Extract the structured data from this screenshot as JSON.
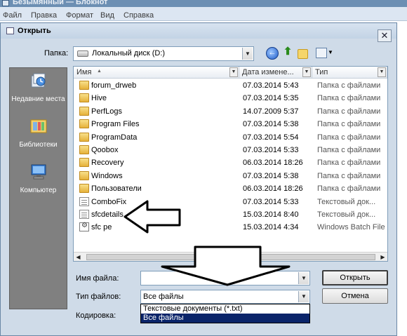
{
  "notepad": {
    "title": "Безымянный — Блокнот",
    "menu": [
      "Файл",
      "Правка",
      "Формат",
      "Вид",
      "Справка"
    ]
  },
  "dialog": {
    "title": "Открыть",
    "close_label": "✕",
    "look_in_label": "Папка:",
    "look_in_value": "Локальный диск (D:)"
  },
  "places": [
    {
      "label": "Недавние места",
      "icon": "recent-places-icon"
    },
    {
      "label": "Библиотеки",
      "icon": "libraries-icon"
    },
    {
      "label": "Компьютер",
      "icon": "computer-icon"
    }
  ],
  "columns": {
    "name": "Имя",
    "date": "Дата измене...",
    "type": "Тип"
  },
  "files": [
    {
      "name": "forum_drweb",
      "date": "07.03.2014 5:43",
      "type": "Папка с файлами",
      "icon": "folder"
    },
    {
      "name": "Hive",
      "date": "07.03.2014 5:35",
      "type": "Папка с файлами",
      "icon": "folder"
    },
    {
      "name": "PerfLogs",
      "date": "14.07.2009 5:37",
      "type": "Папка с файлами",
      "icon": "folder"
    },
    {
      "name": "Program Files",
      "date": "07.03.2014 5:38",
      "type": "Папка с файлами",
      "icon": "folder"
    },
    {
      "name": "ProgramData",
      "date": "07.03.2014 5:54",
      "type": "Папка с файлами",
      "icon": "folder"
    },
    {
      "name": "Qoobox",
      "date": "07.03.2014 5:33",
      "type": "Папка с файлами",
      "icon": "folder"
    },
    {
      "name": "Recovery",
      "date": "06.03.2014 18:26",
      "type": "Папка с файлами",
      "icon": "folder"
    },
    {
      "name": "Windows",
      "date": "07.03.2014 5:38",
      "type": "Папка с файлами",
      "icon": "folder"
    },
    {
      "name": "Пользователи",
      "date": "06.03.2014 18:26",
      "type": "Папка с файлами",
      "icon": "folder"
    },
    {
      "name": "ComboFix",
      "date": "07.03.2014 5:33",
      "type": "Текстовый док...",
      "icon": "doc"
    },
    {
      "name": "sfcdetails",
      "date": "15.03.2014 8:40",
      "type": "Текстовый док...",
      "icon": "doc"
    },
    {
      "name": "sfc pe",
      "date": "15.03.2014 4:34",
      "type": "Windows Batch File",
      "icon": "gear"
    }
  ],
  "form": {
    "filename_label": "Имя файла:",
    "filename_value": "",
    "filetype_label": "Тип файлов:",
    "filetype_value": "Все файлы",
    "encoding_label": "Кодировка:",
    "open_button": "Открыть",
    "cancel_button": "Отмена",
    "filetype_options": [
      "Текстовые документы (*.txt)",
      "Все файлы"
    ],
    "filetype_selected_index": 1
  },
  "colors": {
    "selection": "#0a246a",
    "places_bg": "#808080",
    "dialog_bg": "#cfdbe8"
  }
}
